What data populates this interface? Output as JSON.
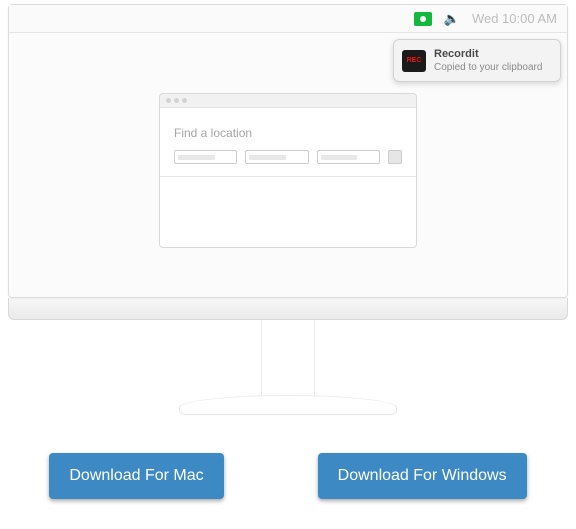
{
  "menubar": {
    "clock": "Wed 10:00 AM"
  },
  "notification": {
    "icon_label": "REC",
    "title": "Recordit",
    "message": "Copied to your clipboard"
  },
  "window": {
    "label": "Find a location"
  },
  "buttons": {
    "mac": "Download For Mac",
    "windows": "Download For Windows"
  }
}
